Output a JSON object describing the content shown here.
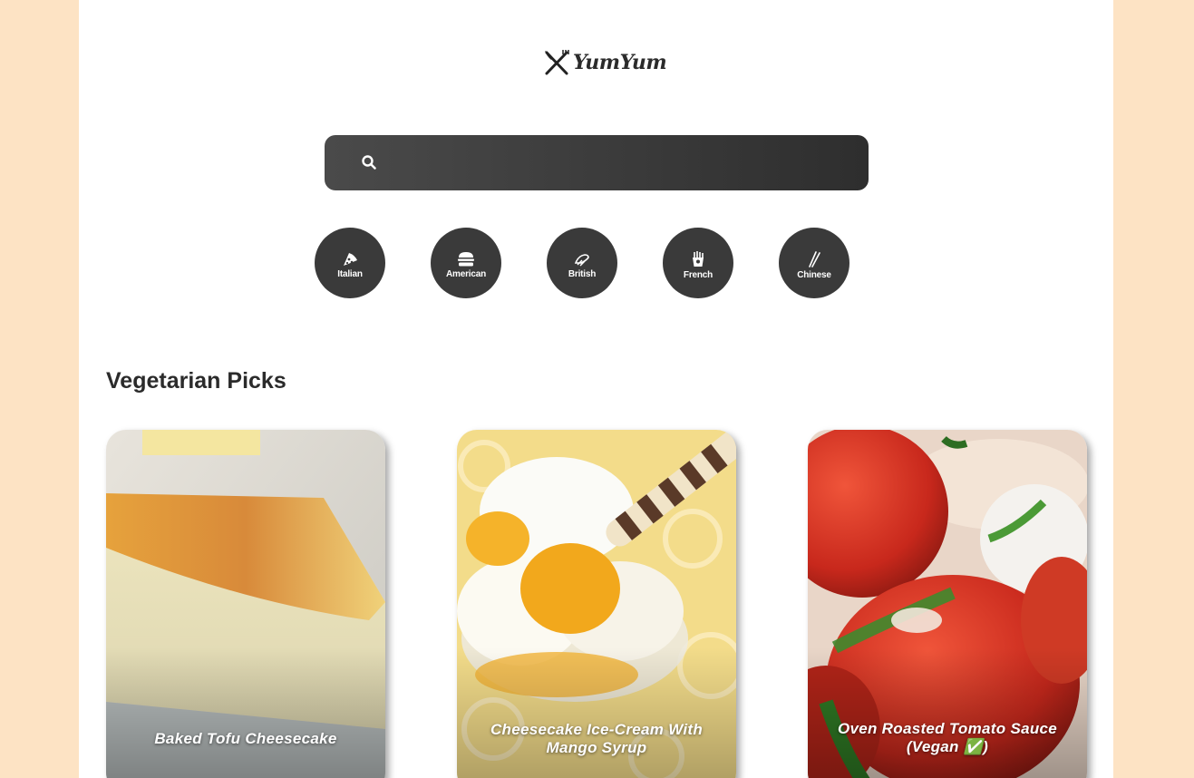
{
  "brand": {
    "name": "YumYum",
    "logo_icon": "crossed-fork-knife-icon"
  },
  "search": {
    "placeholder": "",
    "value": "",
    "icon": "search-icon"
  },
  "cuisines": [
    {
      "label": "Italian",
      "icon": "pizza-slice-icon"
    },
    {
      "label": "American",
      "icon": "burger-icon"
    },
    {
      "label": "British",
      "icon": "fish-chips-icon"
    },
    {
      "label": "French",
      "icon": "french-fries-icon"
    },
    {
      "label": "Chinese",
      "icon": "chopsticks-icon"
    }
  ],
  "section": {
    "title": "Vegetarian Picks"
  },
  "recipes": [
    {
      "title": "Baked Tofu Cheesecake"
    },
    {
      "title": "Cheesecake Ice-Cream With Mango Syrup"
    },
    {
      "title": "Oven Roasted Tomato Sauce (Vegan ✅)"
    }
  ],
  "colors": {
    "page_background": "#fde3c4",
    "content_background": "#ffffff",
    "search_bar": "#3a3a3a",
    "cuisine_button": "#3a3a3a",
    "text_dark": "#2b2b2b"
  }
}
